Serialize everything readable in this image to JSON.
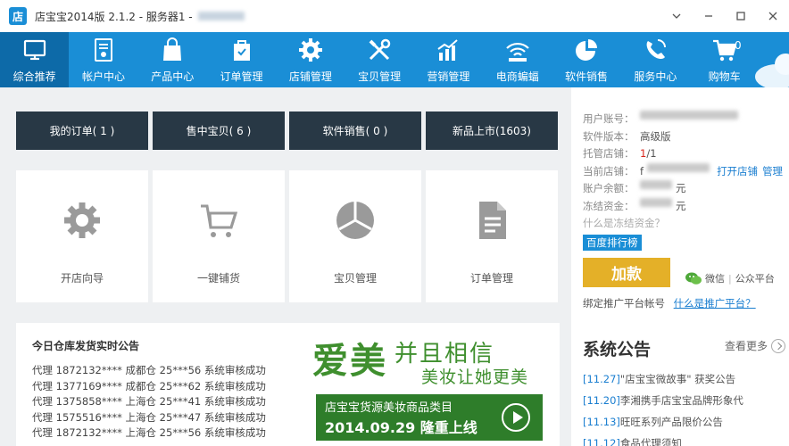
{
  "window": {
    "title": "店宝宝2014版 2.1.2 - 服务器1 -",
    "logo_text": "店"
  },
  "toolbar": {
    "items": [
      {
        "label": "综合推荐",
        "icon": "monitor-icon",
        "active": true
      },
      {
        "label": "帐户中心",
        "icon": "account-icon"
      },
      {
        "label": "产品中心",
        "icon": "shopping-bag-icon"
      },
      {
        "label": "订单管理",
        "icon": "order-bag-icon"
      },
      {
        "label": "店铺管理",
        "icon": "gear-icon"
      },
      {
        "label": "宝贝管理",
        "icon": "tools-icon"
      },
      {
        "label": "营销管理",
        "icon": "bar-chart-icon"
      },
      {
        "label": "电商蝙蝠",
        "icon": "wifi-icon"
      },
      {
        "label": "软件销售",
        "icon": "pie-chart-icon"
      },
      {
        "label": "服务中心",
        "icon": "phone-icon"
      },
      {
        "label": "购物车",
        "icon": "cart-icon",
        "badge": "0"
      }
    ]
  },
  "quick": {
    "buttons": [
      "我的订单( 1 )",
      "售中宝贝( 6 )",
      "软件销售( 0 )",
      "新品上市(1603)"
    ]
  },
  "cards": [
    {
      "label": "开店向导",
      "icon": "gear-icon"
    },
    {
      "label": "一键铺货",
      "icon": "cart-icon"
    },
    {
      "label": "宝贝管理",
      "icon": "pie-chart-icon"
    },
    {
      "label": "订单管理",
      "icon": "document-icon"
    }
  ],
  "notice": {
    "title": "今日仓库发货实时公告",
    "lines": [
      "代理 1872132**** 成都仓 25***56 系统审核成功",
      "代理 1377169**** 成都仓 25***62 系统审核成功",
      "代理 1375858**** 上海仓 25***41 系统审核成功",
      "代理 1575516**** 上海仓 25***47 系统审核成功",
      "代理 1872132**** 上海仓 25***56 系统审核成功"
    ]
  },
  "banner": {
    "big": "爱美",
    "sub1": "并且相信",
    "sub2": "美妆让她更美",
    "line1": "店宝宝货源美妆商品类目",
    "line2": "2014.09.29 隆重上线"
  },
  "account": {
    "rows": [
      {
        "key": "用户账号：",
        "val": ""
      },
      {
        "key": "软件版本：",
        "val": "高级版"
      },
      {
        "key": "托管店铺：",
        "val_red": "1",
        "val": "/1"
      },
      {
        "key": "当前店铺：",
        "val": "f",
        "link1": "打开店铺",
        "link2": "管理"
      },
      {
        "key": "账户余额：",
        "val": "元"
      },
      {
        "key": "冻结资金：",
        "val": "元"
      }
    ],
    "frozen_link": "什么是冻结资金？",
    "baidu_label": "百度排行榜",
    "recharge_label": "加款",
    "wechat_label": "微信",
    "wechat_sep": "|",
    "wechat_platform": "公众平台",
    "bind_text": "绑定推广平台帐号",
    "bind_link": "什么是推广平台？"
  },
  "system_notice": {
    "title": "系统公告",
    "more": "查看更多",
    "items": [
      {
        "date": "[11.27]",
        "text": "\"店宝宝微故事\" 获奖公告"
      },
      {
        "date": "[11.20]",
        "text": "李湘携手店宝宝品牌形象代"
      },
      {
        "date": "[11.13]",
        "text": "旺旺系列产品限价公告"
      },
      {
        "date": "[11.12]",
        "text": "食品代理须知"
      }
    ]
  },
  "colors": {
    "toolbar_bg": "#1a8ed6",
    "toolbar_active": "#0d6aa8",
    "quick_bg": "#283845",
    "recharge": "#e4b028",
    "banner_green": "#3f8f2e"
  }
}
